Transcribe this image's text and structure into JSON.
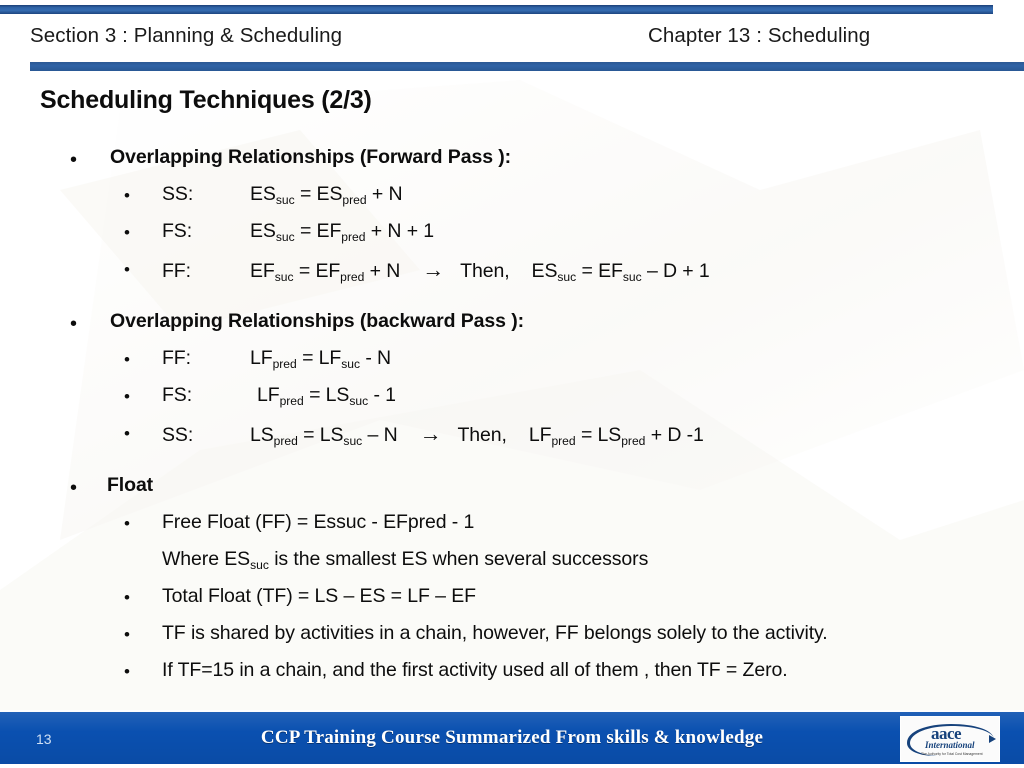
{
  "header": {
    "left": "Section 3 : Planning & Scheduling",
    "right": "Chapter 13 : Scheduling"
  },
  "title": "Scheduling Techniques (2/3)",
  "colors": {
    "rule_blue": "#2f63a6",
    "footer_blue": "#0a50b0",
    "text": "#0d0d0d",
    "page_number": "#cfe0f5"
  },
  "body": {
    "groups": [
      {
        "heading": "Overlapping Relationships (Forward Pass ):",
        "items": [
          {
            "label": "SS:",
            "formula_parts": [
              "ES",
              "suc",
              " = ES",
              "pred",
              " + N"
            ],
            "text": "SS: ES suc = ES pred + N"
          },
          {
            "label": "FS:",
            "text": "FS: ES suc = EF pred + N + 1"
          },
          {
            "label": "FF:",
            "text": "FF: EF suc = EF pred + N  →  Then,  ES suc = EF suc – D + 1",
            "connector": "→",
            "then": "Then,"
          }
        ]
      },
      {
        "heading": "Overlapping Relationships (backward Pass ):",
        "items": [
          {
            "label": "FF:",
            "text": "FF: LF pred = LF suc - N"
          },
          {
            "label": "FS:",
            "text": "FS: LF pred = LS suc - 1"
          },
          {
            "label": "SS:",
            "text": "SS: LS pred = LS suc – N  →  Then,  LF pred = LS pred + D -1",
            "connector": "→",
            "then": "Then,"
          }
        ]
      },
      {
        "heading": "Float",
        "items": [
          {
            "text": "Free Float (FF) = Essuc  -  EFpred  - 1"
          },
          {
            "text": "Where ES suc is the smallest ES when several successors",
            "no_bullet": true
          },
          {
            "text": "Total Float (TF) = LS – ES  =  LF – EF"
          },
          {
            "text": "TF is shared by activities in a chain, however, FF belongs solely to the activity."
          },
          {
            "text": "If TF=15 in a chain, and the first activity used all of them , then TF = Zero."
          }
        ]
      }
    ],
    "fragments": {
      "g1_h": "Overlapping Relationships (Forward Pass ):",
      "g1_i1_label": "SS:",
      "g1_i1_a": "ES",
      "g1_i1_a_sub": "suc",
      "g1_i1_b": " = ES",
      "g1_i1_b_sub": "pred",
      "g1_i1_c": " + N",
      "g1_i2_label": "FS:",
      "g1_i2_a": "ES",
      "g1_i2_a_sub": "suc",
      "g1_i2_b": " = EF",
      "g1_i2_b_sub": "pred",
      "g1_i2_c": " + N + 1",
      "g1_i3_label": "FF:",
      "g1_i3_a": "EF",
      "g1_i3_a_sub": "suc",
      "g1_i3_b": " = EF",
      "g1_i3_b_sub": "pred",
      "g1_i3_c": " + N",
      "g1_i3_arrow": "→",
      "g1_i3_then": "Then,",
      "g1_i3_d": "ES",
      "g1_i3_d_sub": "suc",
      "g1_i3_e": " = EF",
      "g1_i3_e_sub": "suc",
      "g1_i3_f": " – D + 1",
      "g2_h": "Overlapping Relationships (backward Pass ):",
      "g2_i1_label": "FF:",
      "g2_i1_a": "LF",
      "g2_i1_a_sub": "pred",
      "g2_i1_b": " = LF",
      "g2_i1_b_sub": "suc",
      "g2_i1_c": " - N",
      "g2_i2_label": "FS:",
      "g2_i2_a": "LF",
      "g2_i2_a_sub": "pred",
      "g2_i2_b": " = LS",
      "g2_i2_b_sub": "suc",
      "g2_i2_c": " - 1",
      "g2_i3_label": "SS:",
      "g2_i3_a": "LS",
      "g2_i3_a_sub": "pred",
      "g2_i3_b": " = LS",
      "g2_i3_b_sub": "suc",
      "g2_i3_c": " – N",
      "g2_i3_arrow": "→",
      "g2_i3_then": "Then,",
      "g2_i3_d": "LF",
      "g2_i3_d_sub": "pred",
      "g2_i3_e": " = LS",
      "g2_i3_e_sub": "pred",
      "g2_i3_f": " + D -1",
      "g3_h": "Float",
      "g3_i1": "Free Float (FF) = Essuc  -  EFpred  - 1",
      "g3_i2_a": "Where ES",
      "g3_i2_a_sub": "suc",
      "g3_i2_b": " is the smallest ES when several successors",
      "g3_i3": "Total Float (TF) = LS – ES  =  LF – EF",
      "g3_i4": "TF is shared by activities in a chain, however, FF belongs solely to the activity.",
      "g3_i5": "If TF=15 in a chain, and the first activity used all of them , then TF = Zero.",
      "bullet": "•"
    }
  },
  "footer": {
    "page_number": "13",
    "text": "CCP Training Course Summarized From skills & knowledge",
    "logo": {
      "name": "aace",
      "sub": "International",
      "tagline": "The Authority for Total Cost Management"
    }
  }
}
